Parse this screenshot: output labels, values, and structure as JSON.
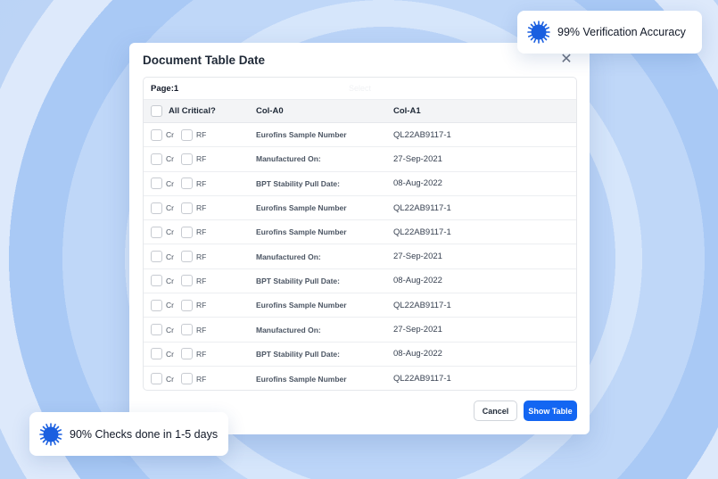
{
  "modal": {
    "title": "Document Table Date",
    "page_label": "Page:1",
    "page_hint": "Select",
    "close_icon": "close-icon"
  },
  "table": {
    "headers": {
      "all_critical": "All Critical?",
      "col_a0": "Col-A0",
      "col_a1": "Col-A1"
    },
    "check_labels": {
      "cr": "Cr",
      "rf": "RF"
    },
    "rows": [
      {
        "a0": "Eurofins Sample Number",
        "a1": "QL22AB9117-1"
      },
      {
        "a0": "Manufactured On:",
        "a1": "27-Sep-2021"
      },
      {
        "a0": "BPT Stability Pull Date:",
        "a1": "08-Aug-2022"
      },
      {
        "a0": "Eurofins Sample Number",
        "a1": "QL22AB9117-1"
      },
      {
        "a0": "Eurofins Sample Number",
        "a1": "QL22AB9117-1"
      },
      {
        "a0": "Manufactured On:",
        "a1": "27-Sep-2021"
      },
      {
        "a0": "BPT Stability Pull Date:",
        "a1": "08-Aug-2022"
      },
      {
        "a0": "Eurofins Sample Number",
        "a1": "QL22AB9117-1"
      },
      {
        "a0": "Manufactured On:",
        "a1": "27-Sep-2021"
      },
      {
        "a0": "BPT Stability Pull Date:",
        "a1": "08-Aug-2022"
      },
      {
        "a0": "Eurofins Sample Number",
        "a1": "QL22AB9117-1"
      }
    ]
  },
  "buttons": {
    "cancel": "Cancel",
    "show_table": "Show Table"
  },
  "badges": {
    "top": {
      "text": "99% Verification Accuracy",
      "icon": "virus-icon"
    },
    "bottom": {
      "text": "90% Checks done in 1-5 days",
      "icon": "virus-icon"
    }
  },
  "colors": {
    "accent": "#1366f2",
    "icon_blue": "#1a5fe0"
  }
}
